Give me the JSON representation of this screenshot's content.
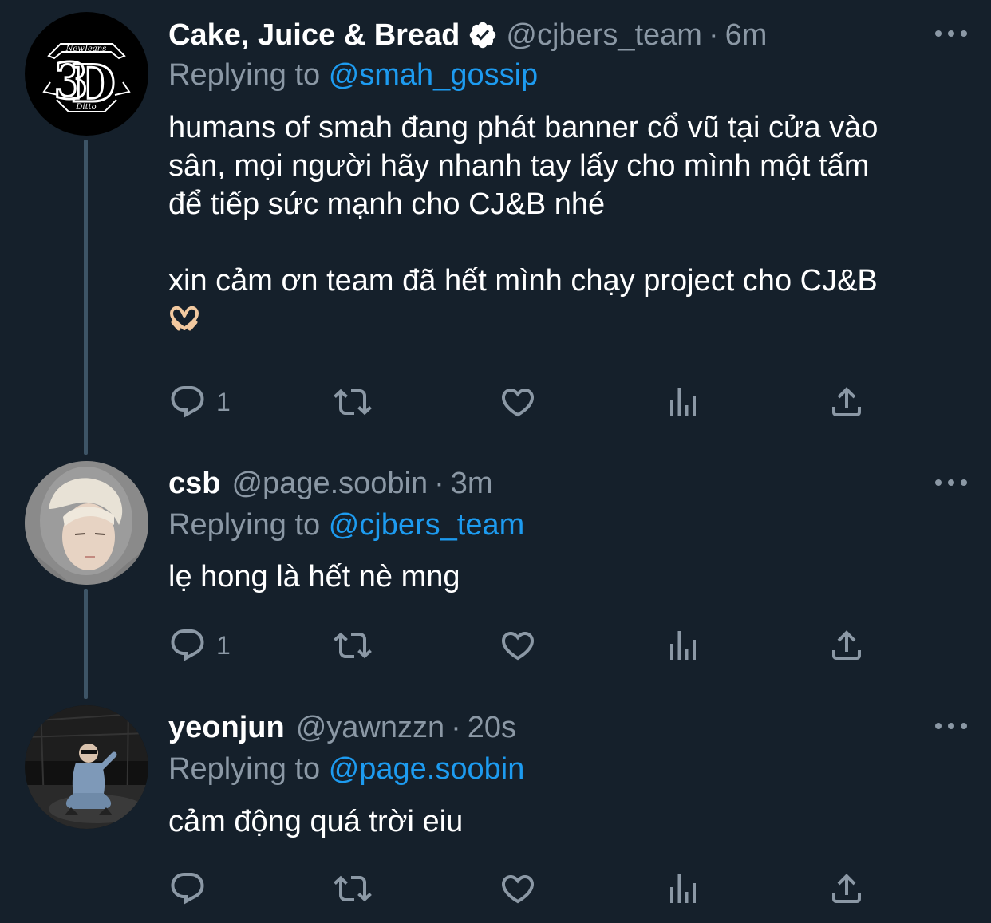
{
  "colors": {
    "background": "#15202b",
    "text_primary": "#ffffff",
    "text_secondary": "#8b98a5",
    "mention": "#1d9bf0",
    "thread_line": "#3d5466"
  },
  "tweets": [
    {
      "name": "Cake, Juice & Bread",
      "verified": true,
      "handle": "@cjbers_team",
      "separator": "·",
      "time": "6m",
      "replying_prefix": "Replying to",
      "replying_to": "@smah_gossip",
      "body_line1": "humans of smah đang phát banner cổ vũ tại cửa vào",
      "body_line2": "sân, mọi người hãy nhanh tay lấy cho mình một tấm",
      "body_line3": "để tiếp sức mạnh cho CJ&B nhé",
      "body_line4": "xin cảm ơn team đã hết mình chạy project cho CJ&B",
      "emoji": "heart-hands-emoji",
      "reply_count": "1",
      "avatar_logo_text_top": "NewJeans",
      "avatar_logo_text_bottom": "Ditto"
    },
    {
      "name": "csb",
      "verified": false,
      "handle": "@page.soobin",
      "separator": "·",
      "time": "3m",
      "replying_prefix": "Replying to",
      "replying_to": "@cjbers_team",
      "body_line1": "lẹ hong là hết nè mng",
      "reply_count": "1"
    },
    {
      "name": "yeonjun",
      "verified": false,
      "handle": "@yawnzzn",
      "separator": "·",
      "time": "20s",
      "replying_prefix": "Replying to",
      "replying_to": "@page.soobin",
      "body_line1": "cảm động quá trời eiu",
      "reply_count": ""
    }
  ],
  "icons": {
    "reply": "reply-icon",
    "retweet": "retweet-icon",
    "like": "heart-icon",
    "analytics": "analytics-icon",
    "share": "share-icon",
    "more": "more-options-icon",
    "verified": "verified-badge-icon"
  }
}
